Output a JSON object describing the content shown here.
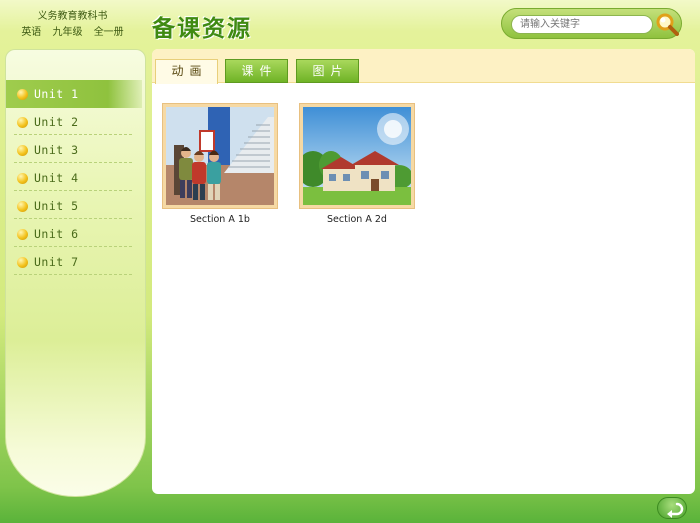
{
  "header": {
    "book_line1": "义务教育教科书",
    "book_subject": "英语",
    "book_grade": "九年级",
    "book_volume": "全一册",
    "page_title": "备课资源",
    "search_placeholder": "请输入关键字"
  },
  "sidebar": {
    "items": [
      {
        "label": "Unit 1",
        "active": true
      },
      {
        "label": "Unit 2",
        "active": false
      },
      {
        "label": "Unit 3",
        "active": false
      },
      {
        "label": "Unit 4",
        "active": false
      },
      {
        "label": "Unit 5",
        "active": false
      },
      {
        "label": "Unit 6",
        "active": false
      },
      {
        "label": "Unit 7",
        "active": false
      }
    ]
  },
  "tabs": [
    {
      "label": "动画",
      "active": true
    },
    {
      "label": "课件",
      "active": false
    },
    {
      "label": "图片",
      "active": false
    }
  ],
  "resources": [
    {
      "caption": "Section A 1b"
    },
    {
      "caption": "Section A 2d"
    }
  ],
  "icons": {
    "search": "magnifier-icon",
    "back": "return-arrow-icon",
    "bullet": "yellow-dot-icon"
  },
  "colors": {
    "accent_green": "#6fb326",
    "active_item": "#8fc23e",
    "title_green": "#3f8a12",
    "tab_bar": "#fdf1c4"
  }
}
